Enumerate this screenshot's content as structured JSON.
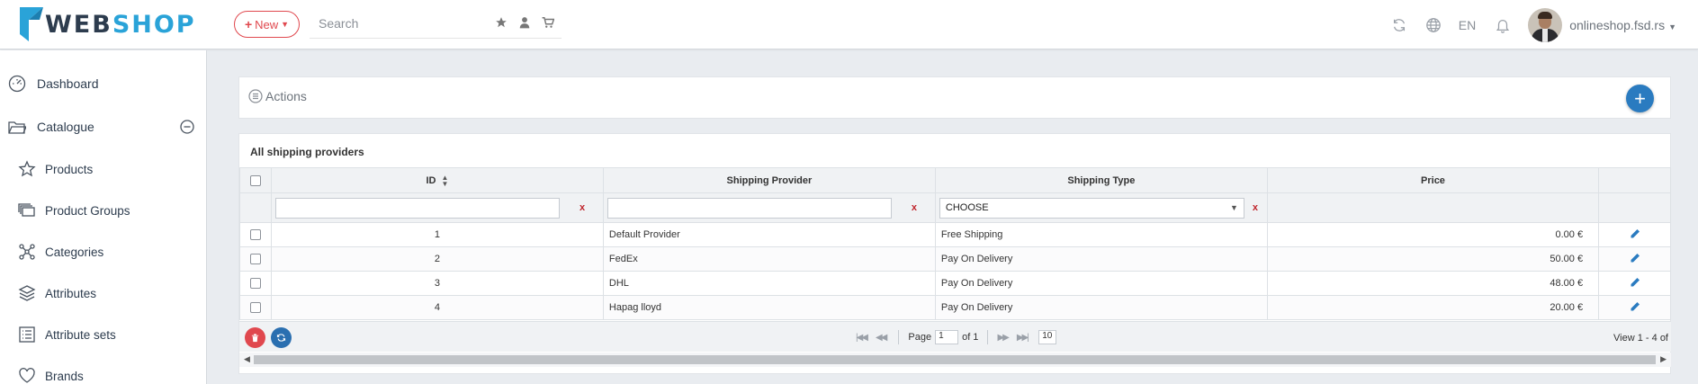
{
  "brand": {
    "logo_web": "WEB",
    "logo_shop": "SHOP",
    "accent": "#2aa3d8",
    "dark": "#2d3c4e"
  },
  "topbar": {
    "new_label": "New",
    "search_placeholder": "Search",
    "search_icons": [
      "star-icon",
      "user-icon",
      "cart-icon"
    ],
    "right_icons": [
      "refresh-icon",
      "globe-icon",
      "bell-icon"
    ],
    "language": "EN",
    "site_name": "onlineshop.fsd.rs"
  },
  "sidebar": {
    "items": [
      {
        "label": "Dashboard",
        "icon": "dashboard-icon"
      },
      {
        "label": "Catalogue",
        "icon": "folder-icon"
      },
      {
        "label": "Products",
        "icon": "star-icon"
      },
      {
        "label": "Product Groups",
        "icon": "stack-icon"
      },
      {
        "label": "Categories",
        "icon": "tree-icon"
      },
      {
        "label": "Attributes",
        "icon": "layers-icon"
      },
      {
        "label": "Attribute sets",
        "icon": "list-icon"
      },
      {
        "label": "Brands",
        "icon": "heart-icon"
      }
    ]
  },
  "actions": {
    "title": "Actions",
    "add_symbol": "+"
  },
  "grid": {
    "title": "All shipping providers",
    "columns": {
      "id": "ID",
      "provider": "Shipping Provider",
      "type": "Shipping Type",
      "price": "Price"
    },
    "filters": {
      "id": "",
      "provider": "",
      "type": "CHOOSE",
      "clear": "x"
    },
    "rows": [
      {
        "id": "1",
        "provider": "Default Provider",
        "type": "Free Shipping",
        "price": "0.00 €"
      },
      {
        "id": "2",
        "provider": "FedEx",
        "type": "Pay On Delivery",
        "price": "50.00 €"
      },
      {
        "id": "3",
        "provider": "DHL",
        "type": "Pay On Delivery",
        "price": "48.00 €"
      },
      {
        "id": "4",
        "provider": "Hapag lloyd",
        "type": "Pay On Delivery",
        "price": "20.00 €"
      }
    ],
    "pager": {
      "page_label": "Page",
      "page_value": "1",
      "of_label": "of 1",
      "page_size": "10",
      "view_info": "View 1 - 4 of"
    }
  },
  "colors": {
    "danger": "#e0484e",
    "primary": "#2a7bc0"
  }
}
